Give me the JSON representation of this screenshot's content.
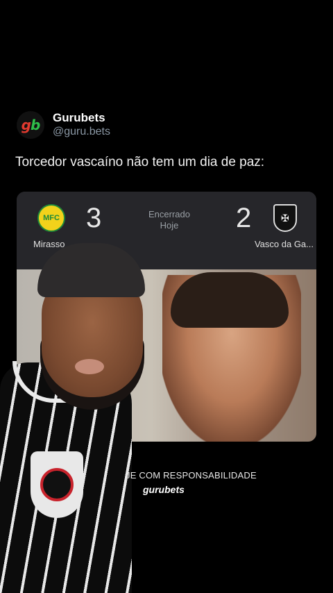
{
  "post": {
    "display_name": "Gurubets",
    "handle": "@guru.bets",
    "avatar_text_1": "g",
    "avatar_text_2": "b",
    "text": "Torcedor vascaíno não tem um dia de paz:"
  },
  "scoreboard": {
    "home_team": "Mirassol",
    "home_team_shown": "Mirasso",
    "home_score": "3",
    "away_score": "2",
    "away_team": "Vasco da Ga...",
    "status_line_1": "Encerrado",
    "status_line_2": "Hoje",
    "home_logo_icon": "mirassol-crest-icon",
    "away_logo_icon": "vasco-crest-icon"
  },
  "overlay": {
    "promo_text": "JE COM RESPONSABILIDADE",
    "brand_text": "gurubets"
  },
  "colors": {
    "background": "#000000",
    "handle_gray": "#8b98a5",
    "card_bg": "#26262a",
    "logo_green": "#2fbf4a",
    "logo_red": "#e23a2f"
  }
}
